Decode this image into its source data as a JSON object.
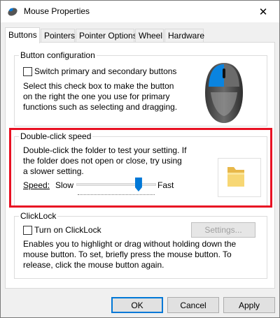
{
  "window": {
    "title": "Mouse Properties",
    "close_glyph": "✕"
  },
  "tabs": [
    "Buttons",
    "Pointers",
    "Pointer Options",
    "Wheel",
    "Hardware"
  ],
  "button_config": {
    "legend": "Button configuration",
    "checkbox_label": "Switch primary and secondary buttons",
    "checkbox_checked": false,
    "description": "Select this check box to make the button on the right the one you use for primary functions such as selecting and dragging."
  },
  "double_click": {
    "legend": "Double-click speed",
    "description": "Double-click the folder to test your setting. If the folder does not open or close, try using a slower setting.",
    "speed_label": "Speed:",
    "slow_label": "Slow",
    "fast_label": "Fast",
    "slider_value_fraction": 0.78
  },
  "clicklock": {
    "legend": "ClickLock",
    "checkbox_label": "Turn on ClickLock",
    "checkbox_checked": false,
    "settings_button": "Settings...",
    "description": "Enables you to highlight or drag without holding down the mouse button. To set, briefly press the mouse button. To release, click the mouse button again."
  },
  "footer": {
    "ok": "OK",
    "cancel": "Cancel",
    "apply": "Apply"
  },
  "colors": {
    "accent": "#0078d7",
    "highlight": "#e81123",
    "folder": "#f5d36b"
  },
  "icons": {
    "title": "mouse-icon",
    "illustration": "mouse-illustration",
    "folder": "folder-icon"
  }
}
